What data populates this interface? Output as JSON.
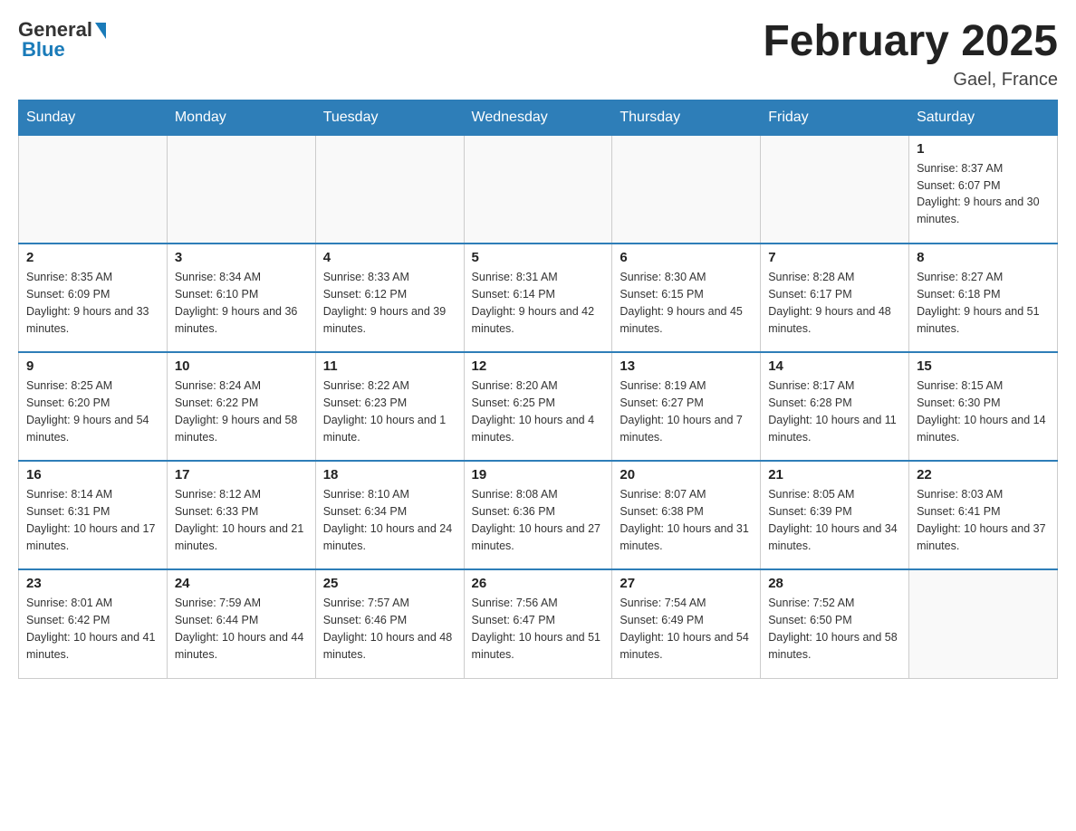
{
  "header": {
    "logo_general": "General",
    "logo_blue": "Blue",
    "month_title": "February 2025",
    "location": "Gael, France"
  },
  "weekdays": [
    "Sunday",
    "Monday",
    "Tuesday",
    "Wednesday",
    "Thursday",
    "Friday",
    "Saturday"
  ],
  "weeks": [
    [
      {
        "day": "",
        "info": ""
      },
      {
        "day": "",
        "info": ""
      },
      {
        "day": "",
        "info": ""
      },
      {
        "day": "",
        "info": ""
      },
      {
        "day": "",
        "info": ""
      },
      {
        "day": "",
        "info": ""
      },
      {
        "day": "1",
        "info": "Sunrise: 8:37 AM\nSunset: 6:07 PM\nDaylight: 9 hours and 30 minutes."
      }
    ],
    [
      {
        "day": "2",
        "info": "Sunrise: 8:35 AM\nSunset: 6:09 PM\nDaylight: 9 hours and 33 minutes."
      },
      {
        "day": "3",
        "info": "Sunrise: 8:34 AM\nSunset: 6:10 PM\nDaylight: 9 hours and 36 minutes."
      },
      {
        "day": "4",
        "info": "Sunrise: 8:33 AM\nSunset: 6:12 PM\nDaylight: 9 hours and 39 minutes."
      },
      {
        "day": "5",
        "info": "Sunrise: 8:31 AM\nSunset: 6:14 PM\nDaylight: 9 hours and 42 minutes."
      },
      {
        "day": "6",
        "info": "Sunrise: 8:30 AM\nSunset: 6:15 PM\nDaylight: 9 hours and 45 minutes."
      },
      {
        "day": "7",
        "info": "Sunrise: 8:28 AM\nSunset: 6:17 PM\nDaylight: 9 hours and 48 minutes."
      },
      {
        "day": "8",
        "info": "Sunrise: 8:27 AM\nSunset: 6:18 PM\nDaylight: 9 hours and 51 minutes."
      }
    ],
    [
      {
        "day": "9",
        "info": "Sunrise: 8:25 AM\nSunset: 6:20 PM\nDaylight: 9 hours and 54 minutes."
      },
      {
        "day": "10",
        "info": "Sunrise: 8:24 AM\nSunset: 6:22 PM\nDaylight: 9 hours and 58 minutes."
      },
      {
        "day": "11",
        "info": "Sunrise: 8:22 AM\nSunset: 6:23 PM\nDaylight: 10 hours and 1 minute."
      },
      {
        "day": "12",
        "info": "Sunrise: 8:20 AM\nSunset: 6:25 PM\nDaylight: 10 hours and 4 minutes."
      },
      {
        "day": "13",
        "info": "Sunrise: 8:19 AM\nSunset: 6:27 PM\nDaylight: 10 hours and 7 minutes."
      },
      {
        "day": "14",
        "info": "Sunrise: 8:17 AM\nSunset: 6:28 PM\nDaylight: 10 hours and 11 minutes."
      },
      {
        "day": "15",
        "info": "Sunrise: 8:15 AM\nSunset: 6:30 PM\nDaylight: 10 hours and 14 minutes."
      }
    ],
    [
      {
        "day": "16",
        "info": "Sunrise: 8:14 AM\nSunset: 6:31 PM\nDaylight: 10 hours and 17 minutes."
      },
      {
        "day": "17",
        "info": "Sunrise: 8:12 AM\nSunset: 6:33 PM\nDaylight: 10 hours and 21 minutes."
      },
      {
        "day": "18",
        "info": "Sunrise: 8:10 AM\nSunset: 6:34 PM\nDaylight: 10 hours and 24 minutes."
      },
      {
        "day": "19",
        "info": "Sunrise: 8:08 AM\nSunset: 6:36 PM\nDaylight: 10 hours and 27 minutes."
      },
      {
        "day": "20",
        "info": "Sunrise: 8:07 AM\nSunset: 6:38 PM\nDaylight: 10 hours and 31 minutes."
      },
      {
        "day": "21",
        "info": "Sunrise: 8:05 AM\nSunset: 6:39 PM\nDaylight: 10 hours and 34 minutes."
      },
      {
        "day": "22",
        "info": "Sunrise: 8:03 AM\nSunset: 6:41 PM\nDaylight: 10 hours and 37 minutes."
      }
    ],
    [
      {
        "day": "23",
        "info": "Sunrise: 8:01 AM\nSunset: 6:42 PM\nDaylight: 10 hours and 41 minutes."
      },
      {
        "day": "24",
        "info": "Sunrise: 7:59 AM\nSunset: 6:44 PM\nDaylight: 10 hours and 44 minutes."
      },
      {
        "day": "25",
        "info": "Sunrise: 7:57 AM\nSunset: 6:46 PM\nDaylight: 10 hours and 48 minutes."
      },
      {
        "day": "26",
        "info": "Sunrise: 7:56 AM\nSunset: 6:47 PM\nDaylight: 10 hours and 51 minutes."
      },
      {
        "day": "27",
        "info": "Sunrise: 7:54 AM\nSunset: 6:49 PM\nDaylight: 10 hours and 54 minutes."
      },
      {
        "day": "28",
        "info": "Sunrise: 7:52 AM\nSunset: 6:50 PM\nDaylight: 10 hours and 58 minutes."
      },
      {
        "day": "",
        "info": ""
      }
    ]
  ]
}
